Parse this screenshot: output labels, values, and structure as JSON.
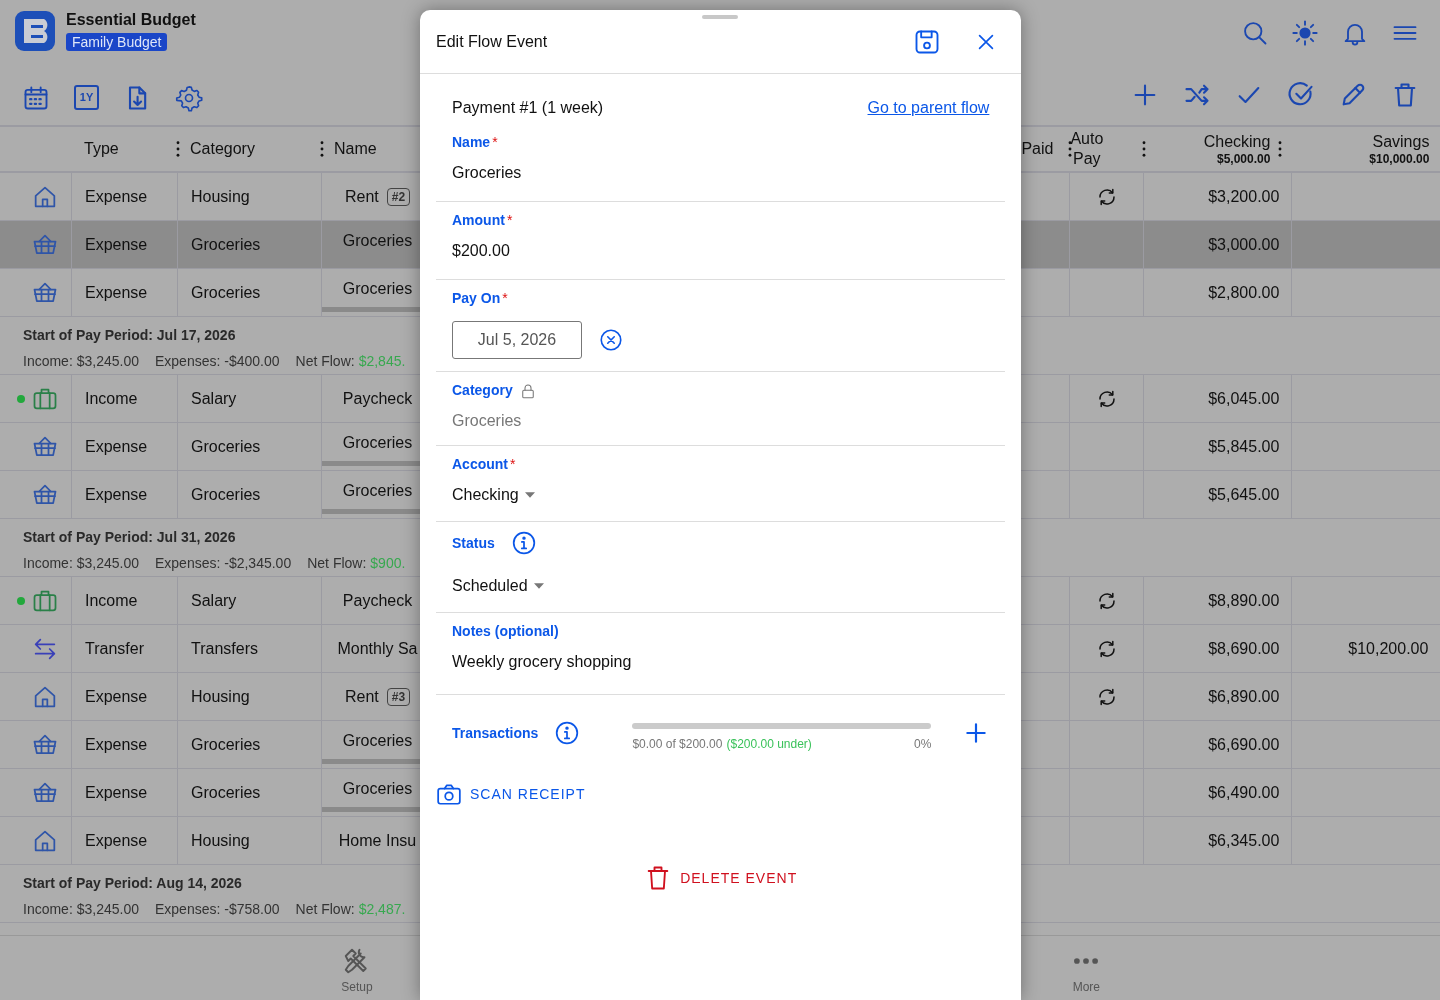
{
  "app": {
    "title": "Essential Budget",
    "budget": "Family Budget",
    "year_label": "1Y"
  },
  "table": {
    "columns": [
      {
        "label": "Type"
      },
      {
        "label": "Category"
      },
      {
        "label": "Name"
      },
      {
        "label": "Paid"
      },
      {
        "label": "Auto",
        "label2": "Pay"
      },
      {
        "label": "Checking",
        "sub": "$5,000.00"
      },
      {
        "label": "Savings",
        "sub": "$10,000.00"
      }
    ],
    "rows": [
      {
        "kind": "house",
        "status_dot": false,
        "type": "Expense",
        "category": "Housing",
        "name": "Rent",
        "tag": "#2",
        "auto_pay": true,
        "checking": "$3,200.00",
        "selected": false
      },
      {
        "kind": "basket",
        "status_dot": false,
        "type": "Expense",
        "category": "Groceries",
        "name": "Groceries",
        "auto_pay": false,
        "checking": "$3,000.00",
        "selected": true
      },
      {
        "kind": "basket",
        "status_dot": false,
        "type": "Expense",
        "category": "Groceries",
        "name": "Groceries",
        "level": 0,
        "auto_pay": false,
        "checking": "$2,800.00",
        "selected": false
      },
      {
        "kind": "period",
        "title": "Start of Pay Period: Jul 17, 2026",
        "income": "Income: $3,245.00",
        "expenses": "Expenses: -$400.00",
        "net_label": "Net Flow:",
        "net_value": "$2,845."
      },
      {
        "kind": "briefcase",
        "status_dot": true,
        "type": "Income",
        "category": "Salary",
        "name": "Paycheck",
        "auto_pay": true,
        "checking": "$6,045.00",
        "selected": false
      },
      {
        "kind": "basket",
        "status_dot": false,
        "type": "Expense",
        "category": "Groceries",
        "name": "Groceries",
        "level": 0,
        "auto_pay": false,
        "checking": "$5,845.00",
        "selected": false
      },
      {
        "kind": "basket",
        "status_dot": false,
        "type": "Expense",
        "category": "Groceries",
        "name": "Groceries",
        "level": 0,
        "auto_pay": false,
        "checking": "$5,645.00",
        "selected": false
      },
      {
        "kind": "period",
        "title": "Start of Pay Period: Jul 31, 2026",
        "income": "Income: $3,245.00",
        "expenses": "Expenses: -$2,345.00",
        "net_label": "Net Flow:",
        "net_value": "$900."
      },
      {
        "kind": "briefcase",
        "status_dot": true,
        "type": "Income",
        "category": "Salary",
        "name": "Paycheck",
        "auto_pay": true,
        "checking": "$8,890.00",
        "selected": false
      },
      {
        "kind": "transfer",
        "status_dot": false,
        "type": "Transfer",
        "category": "Transfers",
        "name": "Monthly Sa",
        "auto_pay": true,
        "checking": "$8,690.00",
        "savings": "$10,200.00",
        "selected": false
      },
      {
        "kind": "house",
        "status_dot": false,
        "type": "Expense",
        "category": "Housing",
        "name": "Rent",
        "tag": "#3",
        "auto_pay": true,
        "checking": "$6,890.00",
        "selected": false
      },
      {
        "kind": "basket",
        "status_dot": false,
        "type": "Expense",
        "category": "Groceries",
        "name": "Groceries",
        "level": 0,
        "auto_pay": false,
        "checking": "$6,690.00",
        "selected": false
      },
      {
        "kind": "basket",
        "status_dot": false,
        "type": "Expense",
        "category": "Groceries",
        "name": "Groceries",
        "level": 0,
        "auto_pay": false,
        "checking": "$6,490.00",
        "selected": false
      },
      {
        "kind": "house",
        "status_dot": false,
        "type": "Expense",
        "category": "Housing",
        "name": "Home Insu",
        "auto_pay": false,
        "checking": "$6,345.00",
        "selected": false
      },
      {
        "kind": "period",
        "title": "Start of Pay Period: Aug 14, 2026",
        "income": "Income: $3,245.00",
        "expenses": "Expenses: -$758.00",
        "net_label": "Net Flow:",
        "net_value": "$2,487."
      }
    ]
  },
  "tab_bar": [
    {
      "label": "Setup"
    },
    {
      "label": "More"
    }
  ],
  "modal": {
    "title": "Edit Flow Event",
    "subtitle": "Payment #1 (1 week)",
    "parent_link": "Go to parent flow",
    "fields": [
      {
        "kind": "text",
        "label": "Name",
        "required_mark": "*",
        "value": "Groceries"
      },
      {
        "kind": "text",
        "label": "Amount",
        "required_mark": "*",
        "value": "$200.00"
      },
      {
        "kind": "date",
        "label": "Pay On",
        "required_mark": "*",
        "value": "Jul 5, 2026"
      },
      {
        "kind": "locked",
        "label": "Category",
        "value": "Groceries"
      },
      {
        "kind": "select",
        "label": "Account",
        "required_mark": "*",
        "value": "Checking"
      },
      {
        "kind": "select",
        "label": "Status",
        "info": true,
        "value": "Scheduled"
      },
      {
        "kind": "text",
        "label": "Notes (optional)",
        "value": "Weekly grocery shopping"
      }
    ],
    "transactions": {
      "label": "Transactions",
      "level": 0,
      "summary": "$0.00 of $200.00",
      "under": "($200.00 under)",
      "percent": "0%"
    },
    "scan_button": "SCAN RECEIPT",
    "delete_button": "DELETE EVENT"
  }
}
